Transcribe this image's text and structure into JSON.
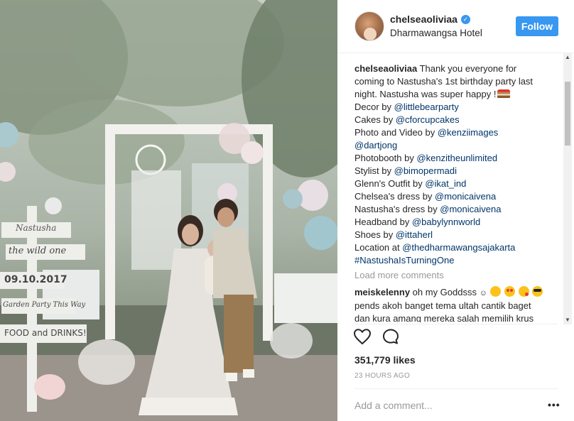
{
  "photo": {
    "signs": [
      "Nastusha",
      "the wild one",
      "09.10.2017",
      "Garden Party This Way",
      "FOOD and DRINKS!"
    ]
  },
  "header": {
    "username": "chelseaoliviaa",
    "location": "Dharmawangsa Hotel",
    "follow_label": "Follow"
  },
  "caption": {
    "username": "chelseaoliviaa",
    "line1": "Thank you everyone for",
    "line2": "coming to Nastusha's 1st birthday party last",
    "line3": "night. Nastusha was super happy !",
    "credits": [
      {
        "prefix": "Decor by ",
        "mention": "@littlebearparty"
      },
      {
        "prefix": "Cakes by ",
        "mention": "@cforcupcakes"
      },
      {
        "prefix": "Photo and Video by ",
        "mention": "@kenziimages"
      },
      {
        "prefix": "",
        "mention": "@dartjong"
      },
      {
        "prefix": "Photobooth by ",
        "mention": "@kenzitheunlimited"
      },
      {
        "prefix": "Stylist by ",
        "mention": "@bimopermadi"
      },
      {
        "prefix": "Glenn's Outfit by ",
        "mention": "@ikat_ind"
      },
      {
        "prefix": "Chelsea's dress by ",
        "mention": "@monicaivena"
      },
      {
        "prefix": "Nastusha's dress by ",
        "mention": "@monicaivena"
      },
      {
        "prefix": "Headband by ",
        "mention": "@babylynnworld"
      },
      {
        "prefix": "Shoes by ",
        "mention": "@ittaherl"
      },
      {
        "prefix": "Location at ",
        "mention": "@thedharmawangsajakarta"
      },
      {
        "prefix": "",
        "mention": "#NastushaIsTurningOne"
      }
    ]
  },
  "load_more": "Load more comments",
  "reply": {
    "username": "meiskelenny",
    "text1": "oh my Goddsss",
    "text2": "pends akoh banget tema ultah cantik baget",
    "text3": "dan kura amang mereka salah memilih krus"
  },
  "likes": "351,779 likes",
  "timestamp": "23 HOURS AGO",
  "add_comment_placeholder": "Add a comment...",
  "more_options": "•••",
  "colors": {
    "accent": "#3897f0",
    "mention": "#003569",
    "muted": "#999999"
  },
  "icons": [
    "verified-badge-icon",
    "heart-icon",
    "comment-icon",
    "more-options-icon",
    "cake-emoji-icon"
  ]
}
